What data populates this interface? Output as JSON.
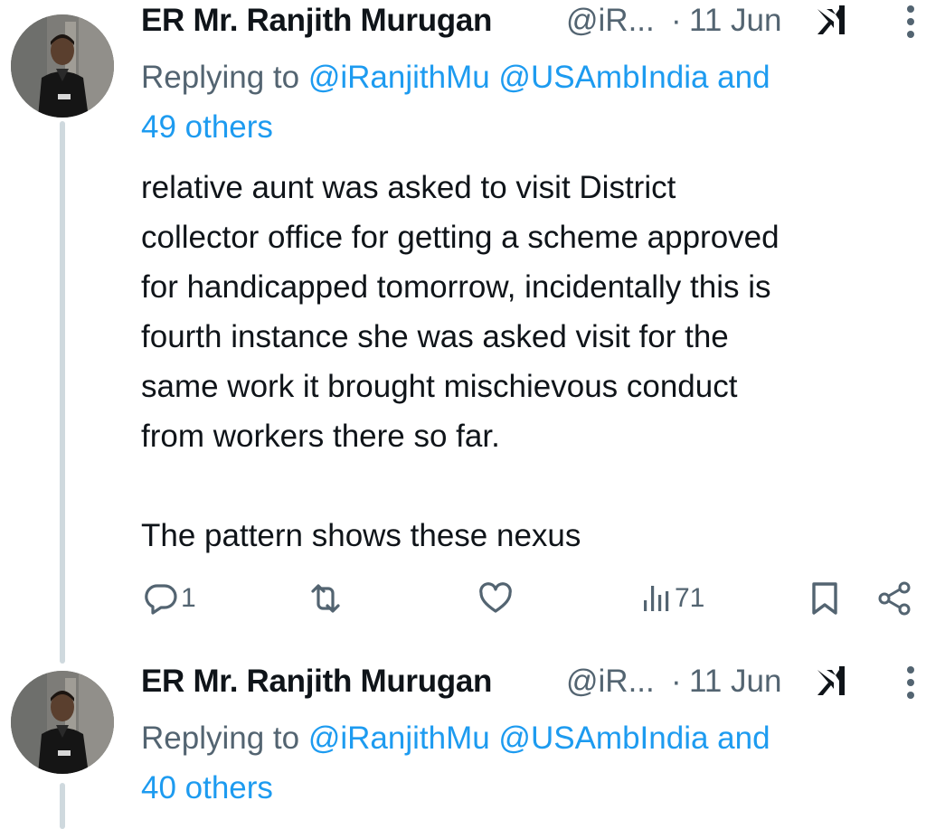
{
  "tweets": [
    {
      "author_name": "ER Mr. Ranjith Murugan",
      "handle": "@iR...",
      "separator": "·",
      "date": "11 Jun",
      "replying_prefix": "Replying to ",
      "replying_links": "@iRanjithMu @USAmbIndia and",
      "replying_more": "49 others",
      "text": "relative aunt was asked to visit District\ncollector office for getting a scheme approved\nfor handicapped tomorrow, incidentally this is\nfourth instance she was asked visit for the\nsame work it brought mischievous conduct\nfrom workers there so far.\n\nThe pattern shows these nexus",
      "actions": {
        "replies": "1",
        "reposts": "",
        "likes": "",
        "views": "71"
      }
    },
    {
      "author_name": "ER Mr. Ranjith Murugan",
      "handle": "@iR...",
      "separator": "·",
      "date": "11 Jun",
      "replying_prefix": "Replying to ",
      "replying_links": "@iRanjithMu @USAmbIndia and",
      "replying_more": "40 others"
    }
  ],
  "icons": {
    "reply": "reply-icon",
    "repost": "repost-icon",
    "like": "heart-icon",
    "views": "views-icon",
    "bookmark": "bookmark-icon",
    "share": "share-icon",
    "grok": "grok-icon",
    "more": "more-icon"
  },
  "colors": {
    "link": "#1d9bf0",
    "secondary": "#536471",
    "text": "#0f1419",
    "thread_line": "#cfd9de"
  }
}
